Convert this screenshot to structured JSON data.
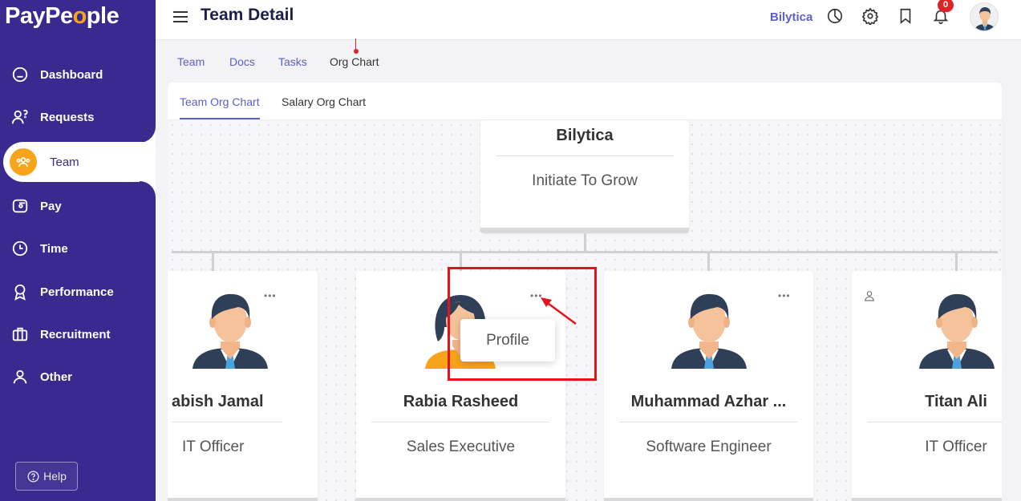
{
  "app": {
    "logo_text_a": "PayPe",
    "logo_text_o": "o",
    "logo_text_b": "ple"
  },
  "sidebar": {
    "items": [
      {
        "label": "Dashboard",
        "icon": "home-icon"
      },
      {
        "label": "Requests",
        "icon": "requests-icon"
      },
      {
        "label": "Team",
        "icon": "team-icon",
        "active": true
      },
      {
        "label": "Pay",
        "icon": "wallet-icon"
      },
      {
        "label": "Time",
        "icon": "clock-icon"
      },
      {
        "label": "Performance",
        "icon": "award-icon"
      },
      {
        "label": "Recruitment",
        "icon": "briefcase-icon"
      },
      {
        "label": "Other",
        "icon": "user-icon"
      }
    ],
    "help_label": "Help"
  },
  "header": {
    "title": "Team Detail",
    "company": "Bilytica",
    "notification_count": "0"
  },
  "tabs": [
    "Team",
    "Docs",
    "Tasks",
    "Org Chart"
  ],
  "subtabs": [
    "Team Org Chart",
    "Salary Org Chart"
  ],
  "org": {
    "root": {
      "name": "Bilytica",
      "subtitle": "Initiate To Grow"
    },
    "members": [
      {
        "name": "abish Jamal",
        "role": "IT Officer"
      },
      {
        "name": "Rabia Rasheed",
        "role": "Sales Executive"
      },
      {
        "name": "Muhammad Azhar ...",
        "role": "Software Engineer"
      },
      {
        "name": "Titan Ali",
        "role": "IT Officer"
      }
    ]
  },
  "menu": {
    "profile_label": "Profile"
  },
  "colors": {
    "sidebar": "#3a2a8f",
    "accent": "#5a5fc9",
    "active_icon": "#f7a41c",
    "badge": "#e02424",
    "highlight": "#e3131c"
  }
}
